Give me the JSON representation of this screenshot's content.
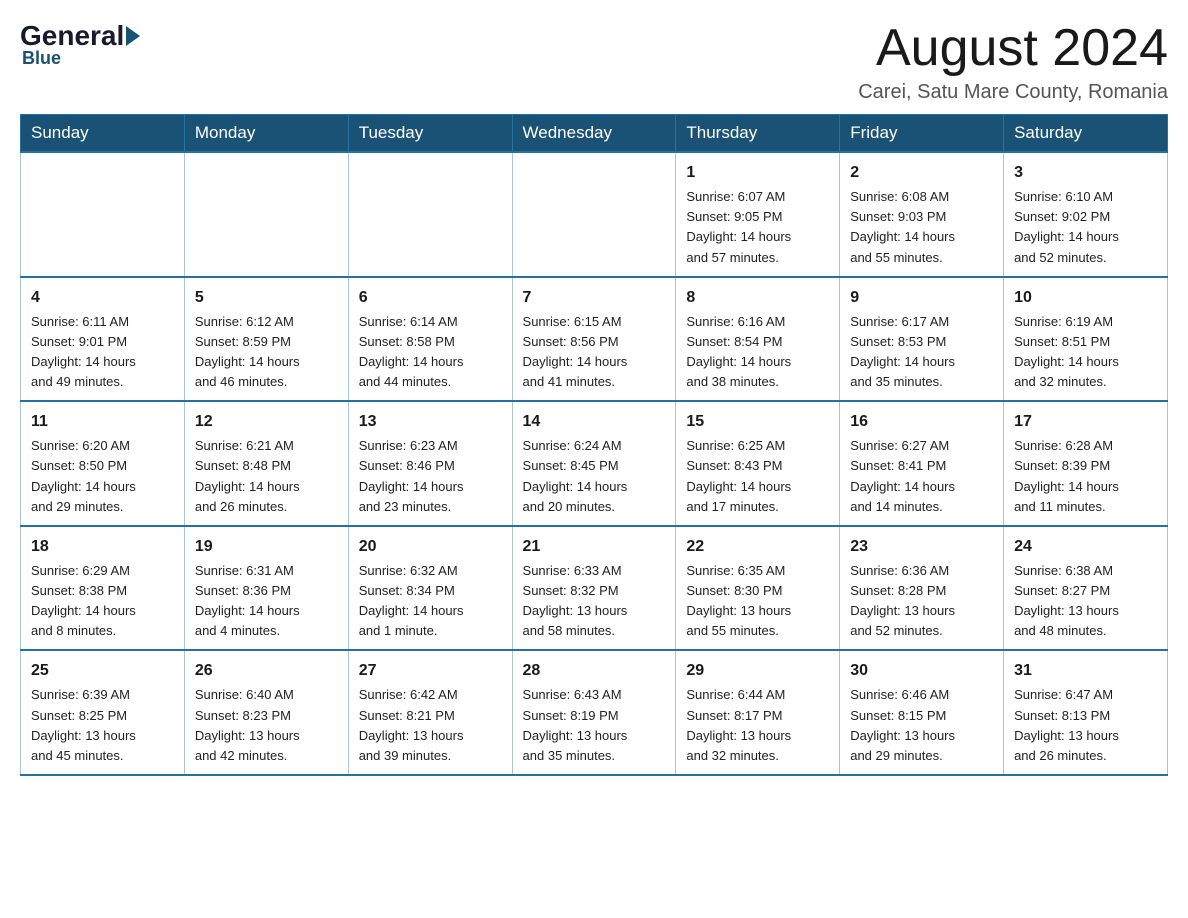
{
  "header": {
    "logo_general": "General",
    "logo_blue": "Blue",
    "month_title": "August 2024",
    "location": "Carei, Satu Mare County, Romania"
  },
  "weekdays": [
    "Sunday",
    "Monday",
    "Tuesday",
    "Wednesday",
    "Thursday",
    "Friday",
    "Saturday"
  ],
  "weeks": [
    [
      {
        "day": "",
        "info": ""
      },
      {
        "day": "",
        "info": ""
      },
      {
        "day": "",
        "info": ""
      },
      {
        "day": "",
        "info": ""
      },
      {
        "day": "1",
        "info": "Sunrise: 6:07 AM\nSunset: 9:05 PM\nDaylight: 14 hours\nand 57 minutes."
      },
      {
        "day": "2",
        "info": "Sunrise: 6:08 AM\nSunset: 9:03 PM\nDaylight: 14 hours\nand 55 minutes."
      },
      {
        "day": "3",
        "info": "Sunrise: 6:10 AM\nSunset: 9:02 PM\nDaylight: 14 hours\nand 52 minutes."
      }
    ],
    [
      {
        "day": "4",
        "info": "Sunrise: 6:11 AM\nSunset: 9:01 PM\nDaylight: 14 hours\nand 49 minutes."
      },
      {
        "day": "5",
        "info": "Sunrise: 6:12 AM\nSunset: 8:59 PM\nDaylight: 14 hours\nand 46 minutes."
      },
      {
        "day": "6",
        "info": "Sunrise: 6:14 AM\nSunset: 8:58 PM\nDaylight: 14 hours\nand 44 minutes."
      },
      {
        "day": "7",
        "info": "Sunrise: 6:15 AM\nSunset: 8:56 PM\nDaylight: 14 hours\nand 41 minutes."
      },
      {
        "day": "8",
        "info": "Sunrise: 6:16 AM\nSunset: 8:54 PM\nDaylight: 14 hours\nand 38 minutes."
      },
      {
        "day": "9",
        "info": "Sunrise: 6:17 AM\nSunset: 8:53 PM\nDaylight: 14 hours\nand 35 minutes."
      },
      {
        "day": "10",
        "info": "Sunrise: 6:19 AM\nSunset: 8:51 PM\nDaylight: 14 hours\nand 32 minutes."
      }
    ],
    [
      {
        "day": "11",
        "info": "Sunrise: 6:20 AM\nSunset: 8:50 PM\nDaylight: 14 hours\nand 29 minutes."
      },
      {
        "day": "12",
        "info": "Sunrise: 6:21 AM\nSunset: 8:48 PM\nDaylight: 14 hours\nand 26 minutes."
      },
      {
        "day": "13",
        "info": "Sunrise: 6:23 AM\nSunset: 8:46 PM\nDaylight: 14 hours\nand 23 minutes."
      },
      {
        "day": "14",
        "info": "Sunrise: 6:24 AM\nSunset: 8:45 PM\nDaylight: 14 hours\nand 20 minutes."
      },
      {
        "day": "15",
        "info": "Sunrise: 6:25 AM\nSunset: 8:43 PM\nDaylight: 14 hours\nand 17 minutes."
      },
      {
        "day": "16",
        "info": "Sunrise: 6:27 AM\nSunset: 8:41 PM\nDaylight: 14 hours\nand 14 minutes."
      },
      {
        "day": "17",
        "info": "Sunrise: 6:28 AM\nSunset: 8:39 PM\nDaylight: 14 hours\nand 11 minutes."
      }
    ],
    [
      {
        "day": "18",
        "info": "Sunrise: 6:29 AM\nSunset: 8:38 PM\nDaylight: 14 hours\nand 8 minutes."
      },
      {
        "day": "19",
        "info": "Sunrise: 6:31 AM\nSunset: 8:36 PM\nDaylight: 14 hours\nand 4 minutes."
      },
      {
        "day": "20",
        "info": "Sunrise: 6:32 AM\nSunset: 8:34 PM\nDaylight: 14 hours\nand 1 minute."
      },
      {
        "day": "21",
        "info": "Sunrise: 6:33 AM\nSunset: 8:32 PM\nDaylight: 13 hours\nand 58 minutes."
      },
      {
        "day": "22",
        "info": "Sunrise: 6:35 AM\nSunset: 8:30 PM\nDaylight: 13 hours\nand 55 minutes."
      },
      {
        "day": "23",
        "info": "Sunrise: 6:36 AM\nSunset: 8:28 PM\nDaylight: 13 hours\nand 52 minutes."
      },
      {
        "day": "24",
        "info": "Sunrise: 6:38 AM\nSunset: 8:27 PM\nDaylight: 13 hours\nand 48 minutes."
      }
    ],
    [
      {
        "day": "25",
        "info": "Sunrise: 6:39 AM\nSunset: 8:25 PM\nDaylight: 13 hours\nand 45 minutes."
      },
      {
        "day": "26",
        "info": "Sunrise: 6:40 AM\nSunset: 8:23 PM\nDaylight: 13 hours\nand 42 minutes."
      },
      {
        "day": "27",
        "info": "Sunrise: 6:42 AM\nSunset: 8:21 PM\nDaylight: 13 hours\nand 39 minutes."
      },
      {
        "day": "28",
        "info": "Sunrise: 6:43 AM\nSunset: 8:19 PM\nDaylight: 13 hours\nand 35 minutes."
      },
      {
        "day": "29",
        "info": "Sunrise: 6:44 AM\nSunset: 8:17 PM\nDaylight: 13 hours\nand 32 minutes."
      },
      {
        "day": "30",
        "info": "Sunrise: 6:46 AM\nSunset: 8:15 PM\nDaylight: 13 hours\nand 29 minutes."
      },
      {
        "day": "31",
        "info": "Sunrise: 6:47 AM\nSunset: 8:13 PM\nDaylight: 13 hours\nand 26 minutes."
      }
    ]
  ]
}
